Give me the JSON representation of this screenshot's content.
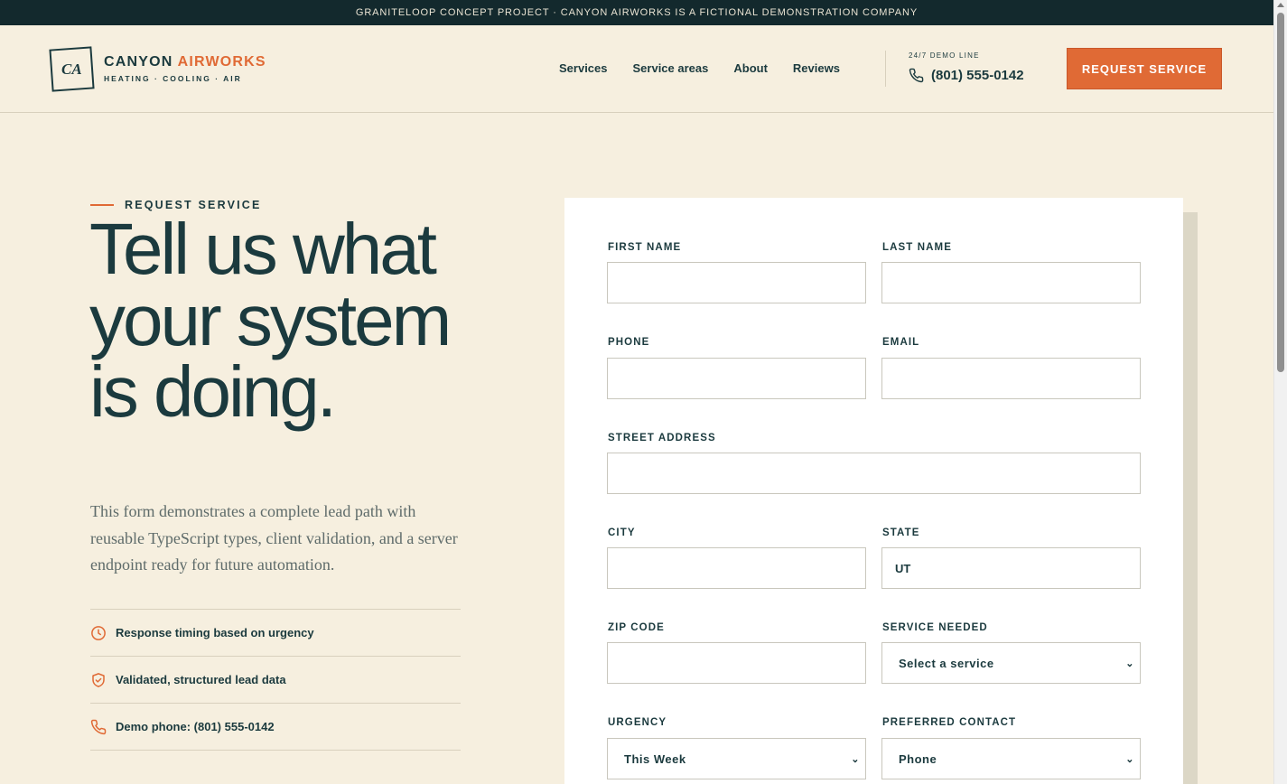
{
  "banner": {
    "text": "GRANITELOOP CONCEPT PROJECT · CANYON AIRWORKS IS A FICTIONAL DEMONSTRATION COMPANY"
  },
  "brand": {
    "mark": "CA",
    "name_primary": "CANYON",
    "name_accent": "AIRWORKS",
    "tagline": "HEATING · COOLING · AIR",
    "accent_color": "#e06a35",
    "ink_color": "#1b3a3e"
  },
  "nav": {
    "items": [
      {
        "label": "Services"
      },
      {
        "label": "Service areas"
      },
      {
        "label": "About"
      },
      {
        "label": "Reviews"
      }
    ]
  },
  "contact": {
    "label": "24/7 DEMO LINE",
    "phone": "(801) 555-0142",
    "icon": "phone-icon"
  },
  "header_cta": {
    "label": "REQUEST SERVICE"
  },
  "hero": {
    "eyebrow": "REQUEST SERVICE",
    "heading": "Tell us what your system is doing.",
    "lede": "This form demonstrates a complete lead path with reusable TypeScript types, client validation, and a server endpoint ready for future automation.",
    "features": [
      {
        "icon": "clock-icon",
        "text": "Response timing based on urgency"
      },
      {
        "icon": "shield-check-icon",
        "text": "Validated, structured lead data"
      },
      {
        "icon": "phone-icon",
        "text": "Demo phone: (801) 555-0142"
      }
    ]
  },
  "form": {
    "first_name": {
      "label": "FIRST NAME",
      "value": ""
    },
    "last_name": {
      "label": "LAST NAME",
      "value": ""
    },
    "phone": {
      "label": "PHONE",
      "value": ""
    },
    "email": {
      "label": "EMAIL",
      "value": ""
    },
    "street": {
      "label": "STREET ADDRESS",
      "value": ""
    },
    "city": {
      "label": "CITY",
      "value": ""
    },
    "state": {
      "label": "STATE",
      "value": "UT"
    },
    "zip": {
      "label": "ZIP CODE",
      "value": ""
    },
    "service": {
      "label": "SERVICE NEEDED",
      "selected": "Select a service"
    },
    "urgency": {
      "label": "URGENCY",
      "selected": "This Week"
    },
    "contact_pref": {
      "label": "PREFERRED CONTACT",
      "selected": "Phone"
    }
  }
}
